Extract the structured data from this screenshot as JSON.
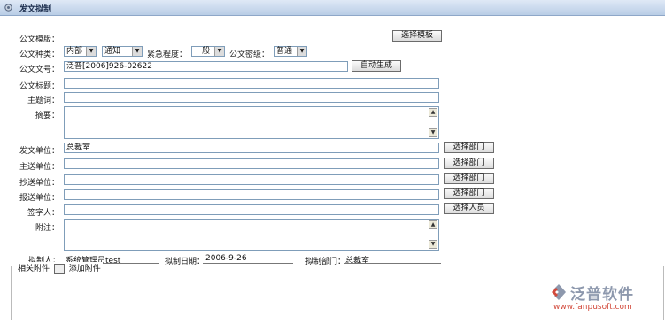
{
  "window": {
    "title": "发文拟制"
  },
  "form": {
    "template_label": "公文模版：",
    "template_button": "选择模板",
    "category_label": "公文种类：",
    "category_value": "内部",
    "type_value": "通知",
    "urgency_label": "紧急程度：",
    "urgency_value": "一般",
    "secret_label": "公文密级：",
    "secret_value": "普通",
    "docno_label": "公文文号：",
    "docno_value": "泛普[2006]926-02622",
    "auto_button": "自动生成",
    "title_label": "公文标题：",
    "title_value": "",
    "subject_label": "主题词：",
    "subject_value": "",
    "abstract_label": "摘要：",
    "abstract_value": "",
    "issuer_label": "发文单位：",
    "issuer_value": "总裁室",
    "to_label": "主送单位：",
    "to_value": "",
    "cc_label": "抄送单位：",
    "cc_value": "",
    "report_label": "报送单位：",
    "report_value": "",
    "signer_label": "签字人：",
    "signer_value": "",
    "note_label": "附注：",
    "note_value": "",
    "select_dept_button": "选择部门",
    "select_person_button": "选择人员"
  },
  "footer": {
    "drafter_label": "拟制人：",
    "drafter_value": "系统管理员test",
    "date_label": "拟制日期：",
    "date_value": "2006-9-26",
    "dept_label": "拟制部门：",
    "dept_value": "总裁室"
  },
  "attachments": {
    "group_label": "相关附件",
    "add_label": "添加附件"
  },
  "logo": {
    "name": "泛普软件",
    "url": "www.fanpusoft.com"
  }
}
